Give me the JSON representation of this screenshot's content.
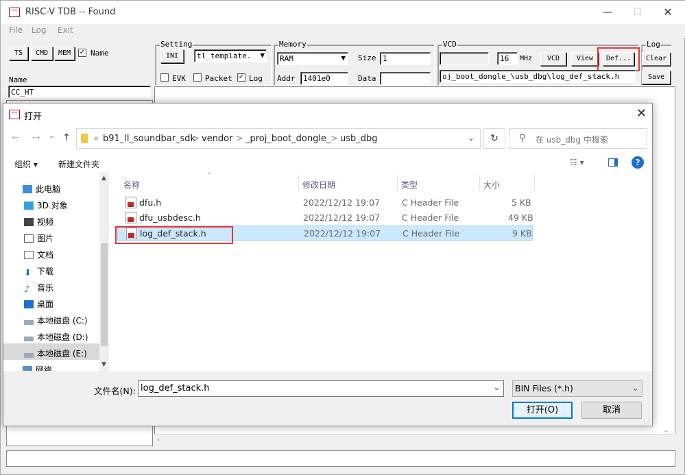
{
  "window": {
    "title": "RISC-V TDB -- Found",
    "menu": [
      "File",
      "Log",
      "Exit"
    ]
  },
  "left_panel": {
    "ts": "TS",
    "cmd": "CMD",
    "mem": "MEM",
    "name_check_label": "Name",
    "name_label": "Name",
    "name_value": "CC_HT"
  },
  "setting": {
    "label": "Setting",
    "ini": "INI",
    "template": "tl_template.",
    "evk": "EVK",
    "packet": "Packet",
    "log": "Log"
  },
  "memory": {
    "label": "Memory",
    "type": "RAM",
    "size_label": "Size",
    "size_value": "1",
    "addr_label": "Addr",
    "addr_value": "1401e0",
    "data_label": "Data",
    "data_value": ""
  },
  "vcd": {
    "label": "VCD",
    "freq": "16",
    "mhz": "MHz",
    "vcd_btn": "VCD",
    "view_btn": "View",
    "def_btn": "Def...",
    "path": "oj_boot_dongle_\\usb_dbg\\log_def_stack.h"
  },
  "log": {
    "label": "Log",
    "clear": "Clear",
    "save": "Save"
  },
  "dialog": {
    "title": "打开",
    "breadcrumb": [
      "«",
      "b91_ll_soundbar_sdk",
      ">",
      "vendor",
      ">",
      "_proj_boot_dongle_",
      ">",
      "usb_dbg"
    ],
    "search_placeholder": "在 usb_dbg 中搜索",
    "organize": "组织 ▾",
    "new_folder": "新建文件夹",
    "nav": [
      {
        "label": "此电脑"
      },
      {
        "label": "3D 对象"
      },
      {
        "label": "视频"
      },
      {
        "label": "图片"
      },
      {
        "label": "文档"
      },
      {
        "label": "下载"
      },
      {
        "label": "音乐"
      },
      {
        "label": "桌面"
      },
      {
        "label": "本地磁盘 (C:)"
      },
      {
        "label": "本地磁盘 (D:)"
      },
      {
        "label": "本地磁盘 (E:)"
      },
      {
        "label": "网络"
      }
    ],
    "columns": {
      "name": "名称",
      "date": "修改日期",
      "type": "类型",
      "size": "大小"
    },
    "files": [
      {
        "name": "dfu.h",
        "date": "2022/12/12 19:07",
        "type": "C Header File",
        "size": "5 KB"
      },
      {
        "name": "dfu_usbdesc.h",
        "date": "2022/12/12 19:07",
        "type": "C Header File",
        "size": "49 KB"
      },
      {
        "name": "log_def_stack.h",
        "date": "2022/12/12 19:07",
        "type": "C Header File",
        "size": "9 KB"
      }
    ],
    "filename_label": "文件名(N):",
    "filename_value": "log_def_stack.h",
    "filter": "BIN Files (*.h)",
    "open": "打开(O)",
    "cancel": "取消"
  }
}
